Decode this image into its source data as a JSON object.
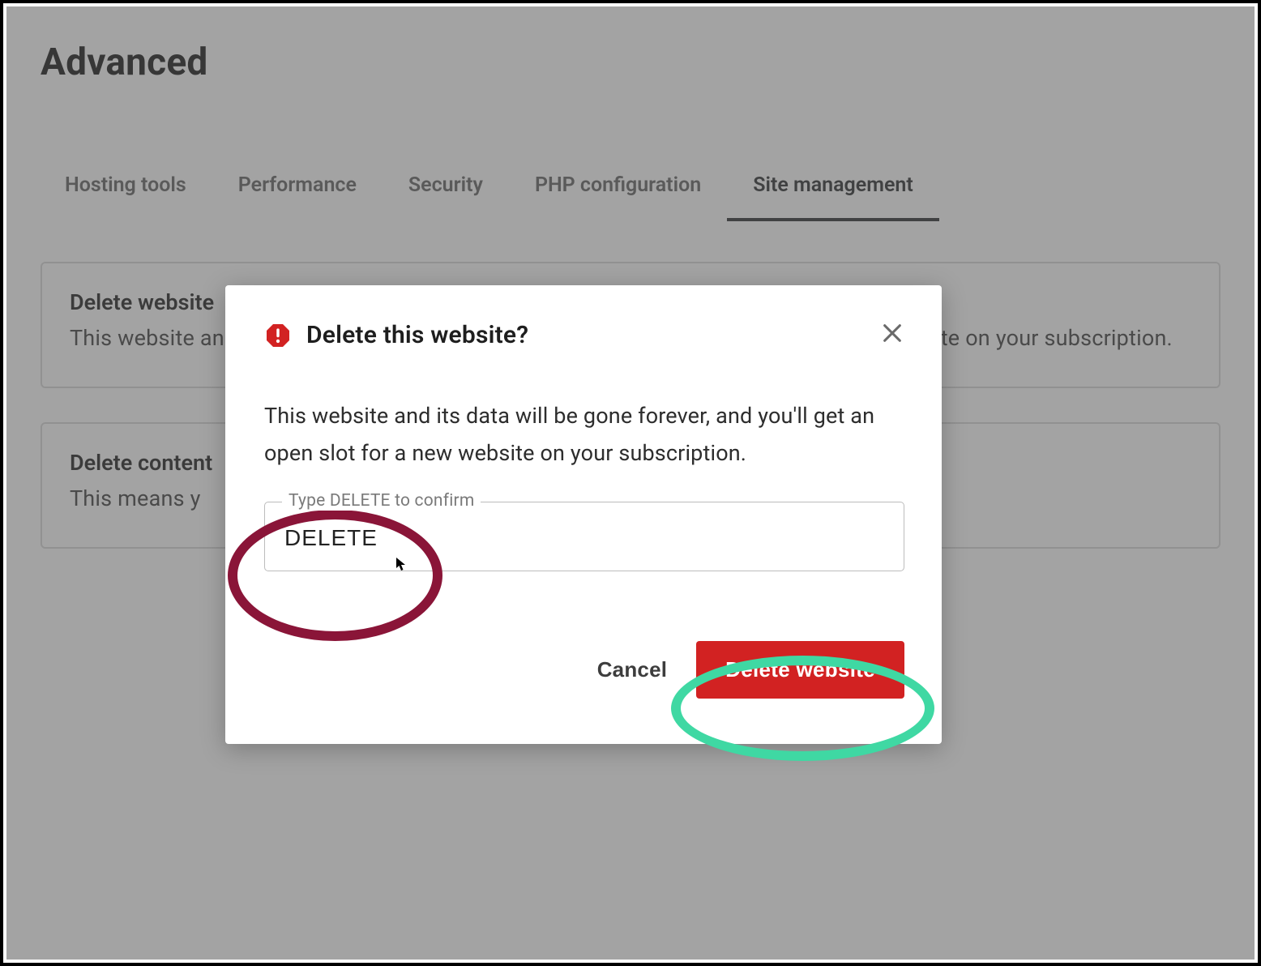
{
  "page": {
    "title": "Advanced"
  },
  "tabs": {
    "items": [
      {
        "label": "Hosting tools",
        "active": false
      },
      {
        "label": "Performance",
        "active": false
      },
      {
        "label": "Security",
        "active": false
      },
      {
        "label": "PHP configuration",
        "active": false
      },
      {
        "label": "Site management",
        "active": true
      }
    ]
  },
  "cards": [
    {
      "title": "Delete website",
      "body": "This website and its data will be gone forever, and you'll get an open slot for a new website on your subscription."
    },
    {
      "title": "Delete content",
      "body": "This means y"
    }
  ],
  "modal": {
    "title": "Delete this website?",
    "body": "This website and its data will be gone forever, and you'll get an open slot for a new website on your subscription.",
    "field_label": "Type DELETE to confirm",
    "field_value": "DELETE",
    "cancel_label": "Cancel",
    "confirm_label": "Delete website"
  },
  "colors": {
    "danger": "#d22222",
    "annot_maroon": "#8a1538",
    "annot_green": "#3fd8a3"
  }
}
